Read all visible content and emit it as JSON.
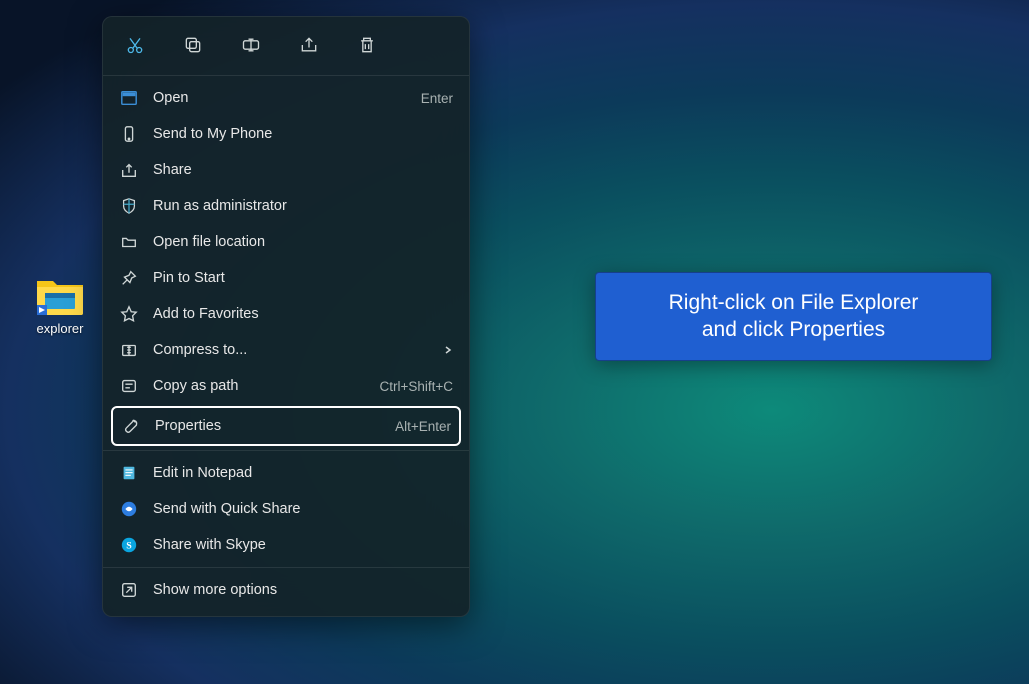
{
  "desktop": {
    "icon_label": "explorer"
  },
  "toolbar": {
    "cut": "cut",
    "copy": "copy",
    "rename": "rename",
    "share": "share",
    "delete": "delete"
  },
  "menu": {
    "open": {
      "label": "Open",
      "accel": "Enter"
    },
    "send_phone": {
      "label": "Send to My Phone"
    },
    "share": {
      "label": "Share"
    },
    "run_admin": {
      "label": "Run as administrator"
    },
    "open_loc": {
      "label": "Open file location"
    },
    "pin_start": {
      "label": "Pin to Start"
    },
    "add_fav": {
      "label": "Add to Favorites"
    },
    "compress": {
      "label": "Compress to..."
    },
    "copy_path": {
      "label": "Copy as path",
      "accel": "Ctrl+Shift+C"
    },
    "properties": {
      "label": "Properties",
      "accel": "Alt+Enter"
    },
    "edit_notepad": {
      "label": "Edit in Notepad"
    },
    "quick_share": {
      "label": "Send with Quick Share"
    },
    "share_skype": {
      "label": "Share with Skype"
    },
    "show_more": {
      "label": "Show more options"
    }
  },
  "callout": {
    "line1": "Right-click on File Explorer",
    "line2": "and click Properties"
  }
}
